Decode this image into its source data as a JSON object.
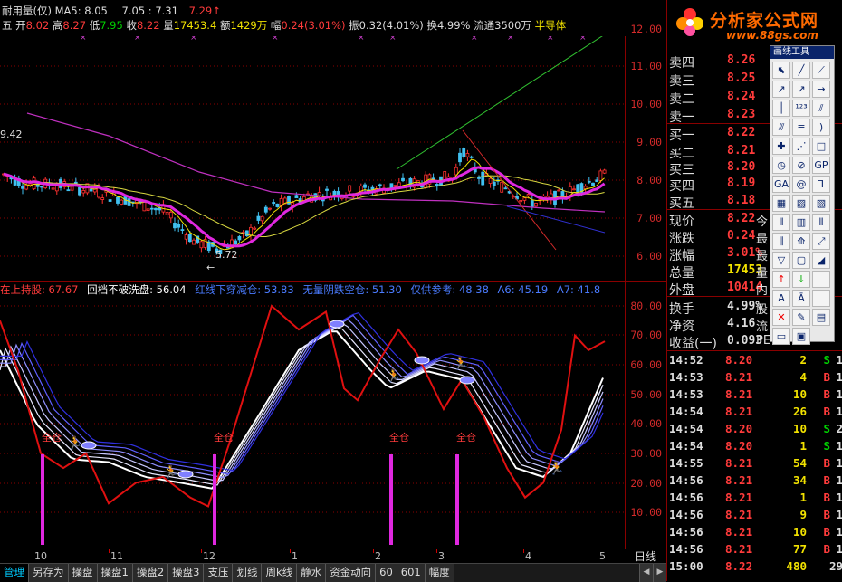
{
  "window": {
    "title_fragment": "耐用量(仅)  MA5: 8.05",
    "line1_left": "7.05 : 7.31",
    "line1_item2": "7.29↑"
  },
  "quote_line": {
    "prefix": "五",
    "open_label": "开",
    "open": "8.02",
    "high_label": "高",
    "high": "8.27",
    "low_label": "低",
    "low": "7.95",
    "close_label": "收",
    "close": "8.22",
    "volume_label": "量",
    "volume": "17453.4",
    "amount_label": "额",
    "amount": "1429万",
    "change_label": "幅",
    "change": "0.24(3.01%)",
    "amplitude_label": "振",
    "amplitude": "0.32(4.01%)",
    "turnover_label": "换",
    "turnover": "4.99%",
    "float_label": "流通",
    "float": "3500万",
    "sector": "半导体"
  },
  "price_axis": [
    "12.00",
    "11.00",
    "10.00",
    "9.00",
    "8.00",
    "7.00",
    "6.00"
  ],
  "price_annotations": {
    "left_value": "9.42",
    "low_value": "5.72"
  },
  "indicator_legend": [
    {
      "text": "在上持股: 67.67",
      "color": "#ff3b3b"
    },
    {
      "text": "回档不破洗盘: 56.04",
      "color": "#ffffff"
    },
    {
      "text": "红线下穿减仓: 53.83",
      "color": "#4a7bff"
    },
    {
      "text": "无量阴跌空仓: 51.30",
      "color": "#4a7bff"
    },
    {
      "text": "仅供参考: 48.38",
      "color": "#4a7bff"
    },
    {
      "text": "A6: 45.19",
      "color": "#4a7bff"
    },
    {
      "text": "A7: 41.8",
      "color": "#4a7bff"
    }
  ],
  "indicator_axis": [
    "80.00",
    "70.00",
    "60.00",
    "50.00",
    "40.00",
    "30.00",
    "20.00",
    "10.00"
  ],
  "signal_label": "全仓",
  "x_axis": [
    "10",
    "11",
    "12",
    "1",
    "2",
    "3",
    "4",
    "5"
  ],
  "period": "日线",
  "tabs": [
    "管理",
    "另存为",
    "操盘",
    "操盘1",
    "操盘2",
    "操盘3",
    "支压",
    "划线",
    "周k线",
    "静水",
    "资金动向",
    "60",
    "601",
    "幅度"
  ],
  "logo": {
    "title": "分析家公式网",
    "url": "www.88gs.com"
  },
  "toolbox_title": "画线工具",
  "orderbook": [
    {
      "label": "卖四",
      "price": "8.26"
    },
    {
      "label": "卖三",
      "price": "8.25"
    },
    {
      "label": "卖二",
      "price": "8.24"
    },
    {
      "label": "卖一",
      "price": "8.23"
    },
    {
      "label": "买一",
      "price": "8.22"
    },
    {
      "label": "买二",
      "price": "8.21"
    },
    {
      "label": "买三",
      "price": "8.20"
    },
    {
      "label": "买四",
      "price": "8.19"
    },
    {
      "label": "买五",
      "price": "8.18"
    }
  ],
  "stats": [
    {
      "label": "现价",
      "value": "8.22",
      "extra": "今"
    },
    {
      "label": "涨跌",
      "value": "0.24",
      "extra": "最"
    },
    {
      "label": "涨幅",
      "value": "3.01%",
      "extra": "最"
    },
    {
      "label": "总量",
      "value": "17453",
      "extra": "量"
    },
    {
      "label": "外盘",
      "value": "10414",
      "extra": "内"
    }
  ],
  "stats2": [
    {
      "label": "换手",
      "value": "4.99%",
      "extra": "股"
    },
    {
      "label": "净资",
      "value": "4.16",
      "extra": "流"
    },
    {
      "label": "收益(一)",
      "value": "0.093",
      "extra": "PE"
    }
  ],
  "ticks": [
    {
      "time": "14:52",
      "price": "8.20",
      "vol": "2",
      "side": "S",
      "cnt": "1"
    },
    {
      "time": "14:53",
      "price": "8.21",
      "vol": "4",
      "side": "B",
      "cnt": "1"
    },
    {
      "time": "14:53",
      "price": "8.21",
      "vol": "10",
      "side": "B",
      "cnt": "1"
    },
    {
      "time": "14:54",
      "price": "8.21",
      "vol": "26",
      "side": "B",
      "cnt": "1"
    },
    {
      "time": "14:54",
      "price": "8.20",
      "vol": "10",
      "side": "S",
      "cnt": "2"
    },
    {
      "time": "14:54",
      "price": "8.20",
      "vol": "1",
      "side": "S",
      "cnt": "1"
    },
    {
      "time": "14:55",
      "price": "8.21",
      "vol": "54",
      "side": "B",
      "cnt": "1"
    },
    {
      "time": "14:56",
      "price": "8.21",
      "vol": "34",
      "side": "B",
      "cnt": "1"
    },
    {
      "time": "14:56",
      "price": "8.21",
      "vol": "1",
      "side": "B",
      "cnt": "1"
    },
    {
      "time": "14:56",
      "price": "8.21",
      "vol": "9",
      "side": "B",
      "cnt": "1"
    },
    {
      "time": "14:56",
      "price": "8.21",
      "vol": "10",
      "side": "B",
      "cnt": "1"
    },
    {
      "time": "14:56",
      "price": "8.21",
      "vol": "77",
      "side": "B",
      "cnt": "1"
    },
    {
      "time": "15:00",
      "price": "8.22",
      "vol": "480",
      "side": "",
      "cnt": "29"
    }
  ],
  "colors": {
    "up": "#ff3b3b",
    "buy": "#ff3b3b",
    "sell": "#00d000",
    "grid": "#8a0000",
    "ma_yellow": "#f2e200",
    "ma_magenta": "#e028e0",
    "trend_green": "#30c030",
    "ribbon_blue": "#4040ff"
  }
}
